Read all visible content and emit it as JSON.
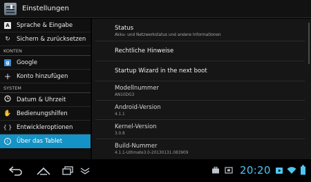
{
  "action_bar": {
    "title": "Einstellungen"
  },
  "left_pane": {
    "items": [
      {
        "kind": "item",
        "label": "Sprache & Eingabe"
      },
      {
        "kind": "item",
        "label": "Sichern & zurücksetzen"
      },
      {
        "kind": "section",
        "label": "KONTEN"
      },
      {
        "kind": "item",
        "label": "Google"
      },
      {
        "kind": "item",
        "label": "Konto hinzufügen"
      },
      {
        "kind": "section",
        "label": "SYSTEM"
      },
      {
        "kind": "item",
        "label": "Datum & Uhrzeit"
      },
      {
        "kind": "item",
        "label": "Bedienungshilfen"
      },
      {
        "kind": "item",
        "label": "Entwickleroptionen"
      },
      {
        "kind": "item",
        "label": "Über das Tablet",
        "selected": true
      }
    ]
  },
  "right_pane": {
    "prefs": [
      {
        "title": "Status",
        "summary": "Akku- und Netzwerkstatus und andere Informationen"
      },
      {
        "title": "Rechtliche Hinweise",
        "summary": ""
      },
      {
        "title": "Startup Wizard in the next boot",
        "summary": ""
      },
      {
        "title": "Modellnummer",
        "summary": "AN10DG3"
      },
      {
        "title": "Android-Version",
        "summary": "4.1.1"
      },
      {
        "title": "Kernel-Version",
        "summary": "3.0.8"
      },
      {
        "title": "Build-Nummer",
        "summary": "4.1.1-Ultimate3.0-20130131.083909"
      }
    ]
  },
  "system_bar": {
    "time": "20:20",
    "accent_color": "#4fc6f0",
    "nav_icons": [
      "back-icon",
      "home-icon",
      "recent-apps-icon",
      "hide-keyboard-icon"
    ],
    "status_icons": [
      "briefcase-icon",
      "screenshot-icon",
      "play-store-icon",
      "wifi-icon",
      "battery-icon"
    ]
  },
  "colors": {
    "selected_row": "#1593c6"
  }
}
